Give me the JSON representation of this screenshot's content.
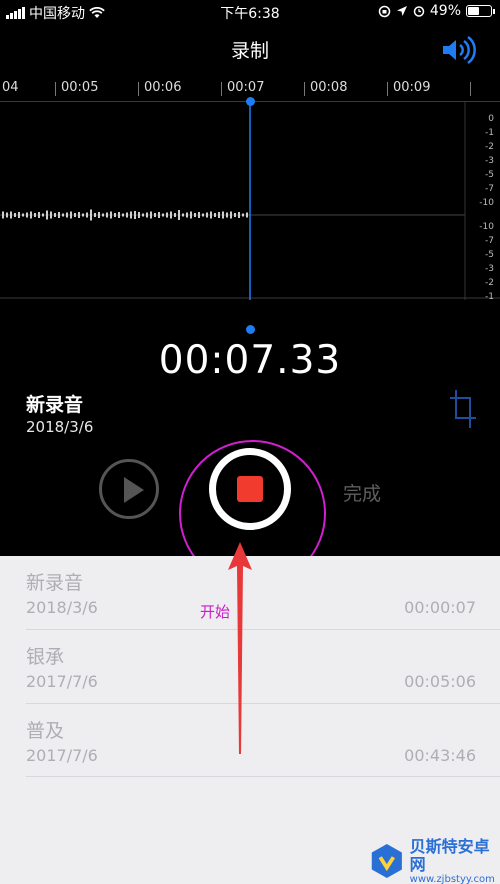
{
  "status_bar": {
    "carrier": "中国移动",
    "time": "下午6:38",
    "battery_percent": "49%",
    "battery_level": 0.49
  },
  "nav": {
    "title": "录制",
    "speaker_icon": "speaker-volume-icon"
  },
  "timeline": {
    "labels": [
      "04",
      "00:05",
      "00:06",
      "00:07",
      "00:08",
      "00:09"
    ]
  },
  "meter": {
    "top_labels": [
      "0",
      "-1",
      "-2",
      "-3",
      "-5",
      "-7",
      "-10"
    ],
    "bottom_labels": [
      "-10",
      "-7",
      "-5",
      "-3",
      "-2",
      "-1",
      "0"
    ]
  },
  "recording": {
    "elapsed": "00:07.33",
    "title": "新录音",
    "date": "2018/3/6"
  },
  "controls": {
    "play_icon": "play-icon",
    "stop_icon": "stop-record-icon",
    "done_label": "完成",
    "crop_icon": "crop-icon"
  },
  "list": [
    {
      "name": "新录音",
      "date": "2018/3/6",
      "duration": "00:00:07"
    },
    {
      "name": "银承",
      "date": "2017/7/6",
      "duration": "00:05:06"
    },
    {
      "name": "普及",
      "date": "2017/7/6",
      "duration": "00:43:46"
    }
  ],
  "annotation": {
    "label": "开始",
    "color": "#d21fd2"
  },
  "watermark": {
    "name": "贝斯特安卓网",
    "url": "www.zjbstyy.com"
  },
  "colors": {
    "accent": "#1f7cf2",
    "stop_red": "#f03b2e",
    "list_bg": "#eeedf0"
  }
}
